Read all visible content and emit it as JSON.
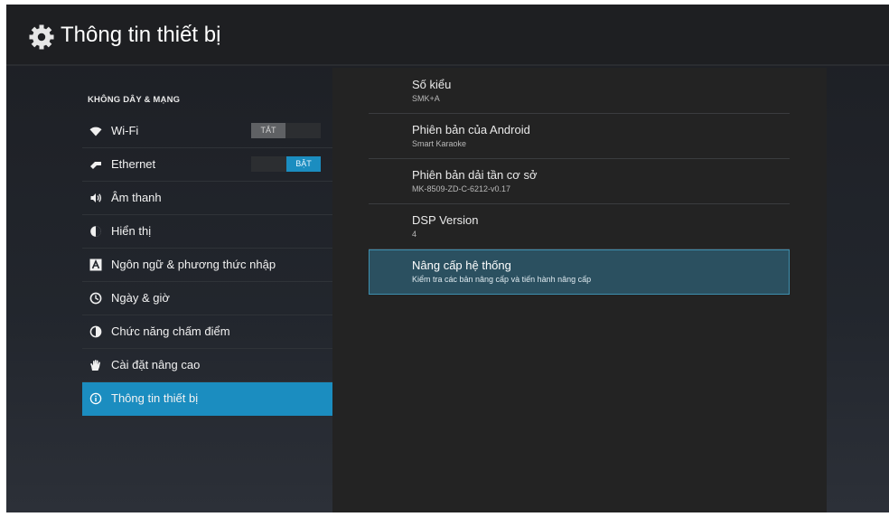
{
  "header": {
    "title": "Thông tin thiết bị",
    "icon": "gear-icon"
  },
  "sidebar": {
    "section_header": "KHÔNG DÂY & MẠNG",
    "selected_color": "#1b8dc0",
    "items": [
      {
        "label": "Wi-Fi",
        "icon": "wifi-icon",
        "toggle": "TẮT"
      },
      {
        "label": "Ethernet",
        "icon": "ethernet-icon",
        "toggle": "BẬT"
      },
      {
        "label": "Âm thanh",
        "icon": "speaker-icon"
      },
      {
        "label": "Hiển thị",
        "icon": "display-icon"
      },
      {
        "label": "Ngôn ngữ & phương thức nhập",
        "icon": "language-icon"
      },
      {
        "label": "Ngày & giờ",
        "icon": "clock-icon"
      },
      {
        "label": "Chức năng chấm điểm",
        "icon": "score-icon"
      },
      {
        "label": "Cài đặt nâng cao",
        "icon": "hand-icon"
      },
      {
        "label": "Thông tin thiết bị",
        "icon": "info-icon",
        "selected": true
      }
    ]
  },
  "details": {
    "items": [
      {
        "title": "Số kiểu",
        "value": "SMK+A"
      },
      {
        "title": "Phiên bản của Android",
        "value": "Smart Karaoke"
      },
      {
        "title": "Phiên bản dải tần cơ sở",
        "value": "MK-8509-ZD-C-6212-v0.17"
      },
      {
        "title": "DSP Version",
        "value": "4"
      },
      {
        "title": "Nâng cấp hệ thống",
        "value": "Kiểm tra các bản nâng cấp và tiến hành nâng cấp",
        "focused": true
      }
    ]
  }
}
